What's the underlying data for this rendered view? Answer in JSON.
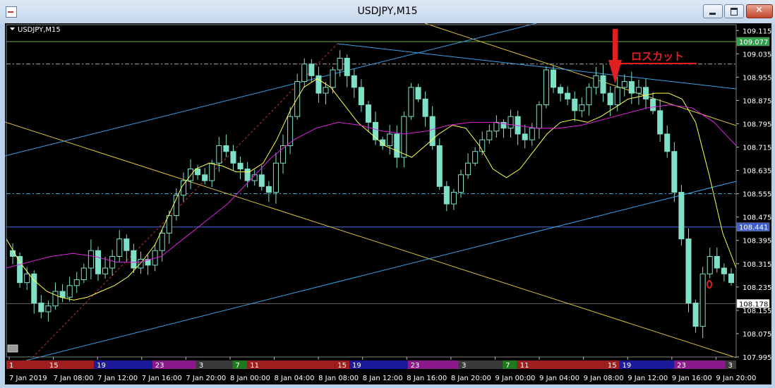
{
  "window": {
    "title": "USDJPY,M15"
  },
  "chart_data": {
    "type": "line",
    "symbol_label": "USDJPY,M15",
    "y_ticks": [
      "109.115",
      "109.035",
      "108.955",
      "108.875",
      "108.795",
      "108.715",
      "108.635",
      "108.555",
      "108.475",
      "108.395",
      "108.315",
      "108.235",
      "108.155",
      "108.075",
      "107.995"
    ],
    "ylim": [
      107.995,
      109.135
    ],
    "price_labels": [
      {
        "value": 109.077,
        "text": "109.077",
        "color": "#2fa34a"
      },
      {
        "value": 108.441,
        "text": "108.441",
        "color": "#3f5ec9"
      },
      {
        "value": 108.178,
        "text": "108.178",
        "color": "#ffffff"
      }
    ],
    "x_labels": [
      "7 Jan 2019",
      "7 Jan 08:00",
      "7 Jan 12:00",
      "7 Jan 16:00",
      "7 Jan 20:00",
      "8 Jan 00:00",
      "8 Jan 04:00",
      "8 Jan 08:00",
      "8 Jan 12:00",
      "8 Jan 16:00",
      "8 Jan 20:00",
      "9 Jan 00:00",
      "9 Jan 04:00",
      "9 Jan 08:00",
      "9 Jan 12:00",
      "9 Jan 16:00",
      "9 Jan 20:00"
    ],
    "session_bar": [
      {
        "label": "1",
        "color": "#a01e1e",
        "from": 0,
        "to": 0.055
      },
      {
        "label": "15",
        "color": "#a01e1e",
        "from": 0.055,
        "to": 0.12
      },
      {
        "label": "19",
        "color": "#1a1a9a",
        "from": 0.12,
        "to": 0.2
      },
      {
        "label": "23",
        "color": "#8a1a8a",
        "from": 0.2,
        "to": 0.26
      },
      {
        "label": "3",
        "color": "#3a3a3a",
        "from": 0.26,
        "to": 0.31
      },
      {
        "label": "7",
        "color": "#1e7a1e",
        "from": 0.31,
        "to": 0.33
      },
      {
        "label": "11",
        "color": "#a01e1e",
        "from": 0.33,
        "to": 0.45
      },
      {
        "label": "15",
        "color": "#a01e1e",
        "from": 0.45,
        "to": 0.47
      },
      {
        "label": "19",
        "color": "#1a1a9a",
        "from": 0.47,
        "to": 0.55
      },
      {
        "label": "23",
        "color": "#8a1a8a",
        "from": 0.55,
        "to": 0.62
      },
      {
        "label": "3",
        "color": "#3a3a3a",
        "from": 0.62,
        "to": 0.68
      },
      {
        "label": "7",
        "color": "#1e7a1e",
        "from": 0.68,
        "to": 0.7
      },
      {
        "label": "11",
        "color": "#a01e1e",
        "from": 0.7,
        "to": 0.82
      },
      {
        "label": "15",
        "color": "#a01e1e",
        "from": 0.82,
        "to": 0.84
      },
      {
        "label": "19",
        "color": "#1a1a9a",
        "from": 0.84,
        "to": 0.915
      },
      {
        "label": "23",
        "color": "#8a1a8a",
        "from": 0.915,
        "to": 0.985
      },
      {
        "label": "3",
        "color": "#3a3a3a",
        "from": 0.985,
        "to": 1.0
      }
    ],
    "annotation": {
      "text": "ロスカット",
      "color": "#e02020"
    },
    "series": [
      {
        "close": [
          108.34,
          108.25,
          108.28,
          108.18,
          108.15,
          108.17,
          108.22,
          108.2,
          108.24,
          108.26,
          108.3,
          108.36,
          108.28,
          108.3,
          108.34,
          108.4,
          108.36,
          108.3,
          108.33,
          108.31,
          108.36,
          108.42,
          108.48,
          108.55,
          108.6,
          108.64,
          108.62,
          108.6,
          108.66,
          108.72,
          108.7,
          108.66,
          108.64,
          108.6,
          108.62,
          108.58,
          108.56,
          108.66,
          108.72,
          108.82,
          108.94,
          109.0,
          108.96,
          108.9,
          108.92,
          108.98,
          109.02,
          108.96,
          108.92,
          108.86,
          108.8,
          108.74,
          108.72,
          108.76,
          108.68,
          108.82,
          108.92,
          108.88,
          108.82,
          108.72,
          108.58,
          108.52,
          108.56,
          108.62,
          108.66,
          108.7,
          108.74,
          108.77,
          108.8,
          108.78,
          108.82,
          108.76,
          108.74,
          108.78,
          108.86,
          108.98,
          108.92,
          108.9,
          108.88,
          108.84,
          108.86,
          108.92,
          108.96,
          108.9,
          108.86,
          108.92,
          108.94,
          108.9,
          108.92,
          108.88,
          108.84,
          108.76,
          108.7,
          108.56,
          108.4,
          108.18,
          108.1,
          108.28,
          108.34,
          108.3,
          108.28,
          108.25
        ]
      },
      {
        "name": "",
        "color": "#ffff4a",
        "values": [
          108.4,
          108.32,
          108.26,
          108.22,
          108.2,
          108.19,
          108.2,
          108.22,
          108.24,
          108.27,
          108.32,
          108.38,
          108.48,
          108.58,
          108.64,
          108.66,
          108.65,
          108.63,
          108.63,
          108.66,
          108.74,
          108.84,
          108.92,
          108.95,
          108.92,
          108.86,
          108.8,
          108.76,
          108.72,
          108.7,
          108.68,
          108.72,
          108.76,
          108.79,
          108.78,
          108.72,
          108.64,
          108.61,
          108.64,
          108.7,
          108.76,
          108.8,
          108.81,
          108.8,
          108.82,
          108.85,
          108.88,
          108.89,
          108.9,
          108.9,
          108.88,
          108.8,
          108.62,
          108.42,
          108.3
        ]
      },
      {
        "name": "",
        "color": "#e020e0",
        "values": [
          108.3,
          108.32,
          108.34,
          108.35,
          108.34,
          108.32,
          108.32,
          108.34,
          108.4,
          108.46,
          108.52,
          108.6,
          108.68,
          108.74,
          108.78,
          108.8,
          108.79,
          108.77,
          108.76,
          108.77,
          108.79,
          108.8,
          108.8,
          108.79,
          108.78,
          108.78,
          108.79,
          108.81,
          108.83,
          108.85,
          108.86,
          108.85,
          108.8,
          108.72
        ]
      }
    ]
  }
}
